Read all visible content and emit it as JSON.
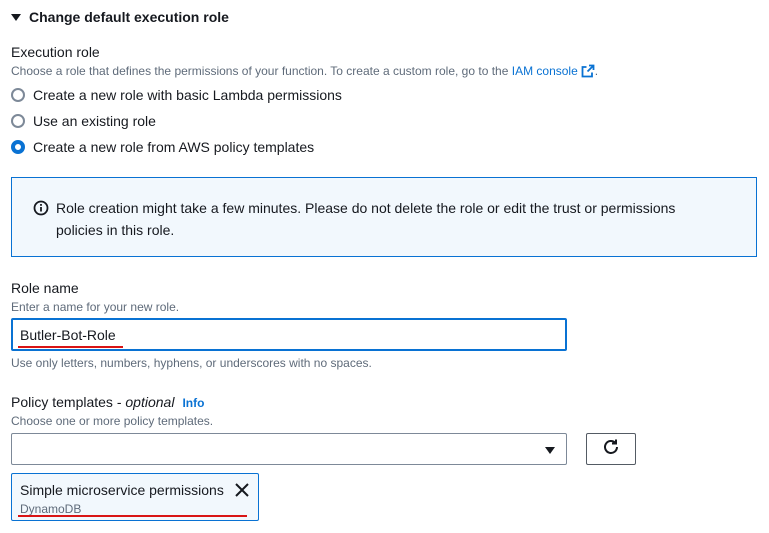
{
  "section": {
    "title": "Change default execution role"
  },
  "execution_role": {
    "label": "Execution role",
    "description_prefix": "Choose a role that defines the permissions of your function. To create a custom role, go to the ",
    "description_link": "IAM console",
    "description_suffix": ".",
    "options": [
      {
        "label": "Create a new role with basic Lambda permissions",
        "selected": false
      },
      {
        "label": "Use an existing role",
        "selected": false
      },
      {
        "label": "Create a new role from AWS policy templates",
        "selected": true
      }
    ]
  },
  "alert": {
    "icon": "info-circle-icon",
    "text": "Role creation might take a few minutes. Please do not delete the role or edit the trust or permissions policies in this role."
  },
  "role_name": {
    "label": "Role name",
    "description": "Enter a name for your new role.",
    "value": "Butler-Bot-Role",
    "constraint": "Use only letters, numbers, hyphens, or underscores with no spaces."
  },
  "policy_templates": {
    "label": "Policy templates",
    "optional_label": "optional",
    "info_label": "Info",
    "description": "Choose one or more policy templates.",
    "selected_value": "",
    "tokens": [
      {
        "title": "Simple microservice permissions",
        "subtitle": "DynamoDB"
      }
    ]
  },
  "colors": {
    "accent": "#0972d3",
    "annotation_red": "#d91515",
    "info_bg": "#f2f8fd"
  }
}
